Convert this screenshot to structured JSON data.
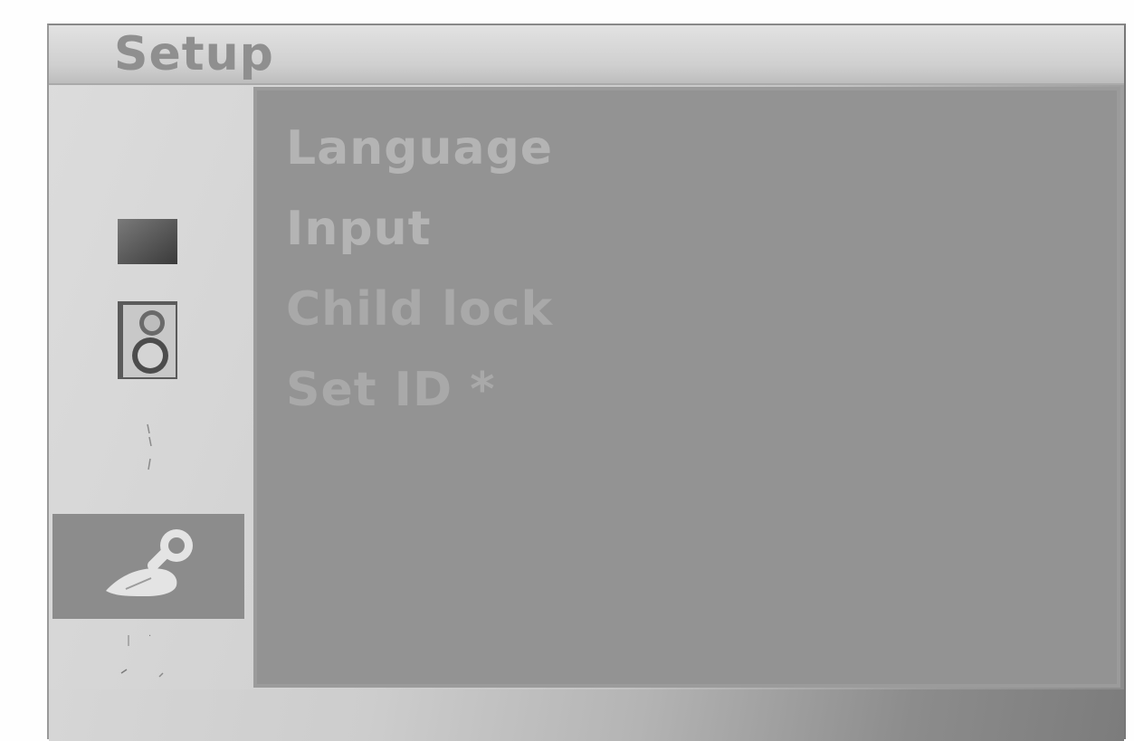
{
  "window": {
    "title": "Setup"
  },
  "sidebar": {
    "items": [
      {
        "icon": "picture-icon",
        "selected": false
      },
      {
        "icon": "speaker-icon",
        "selected": false
      },
      {
        "icon": "clock-icon",
        "selected": false
      },
      {
        "icon": "setup-wrench-icon",
        "selected": true
      },
      {
        "icon": "screen-icon",
        "selected": false
      }
    ]
  },
  "menu": {
    "items": [
      {
        "label": "Language"
      },
      {
        "label": "Input"
      },
      {
        "label": "Child lock"
      },
      {
        "label": "Set ID *"
      }
    ]
  },
  "colors": {
    "panel": "#939393",
    "selected_sidebar": "#8c8c8c",
    "menu_text": "#b4b4b4",
    "title_text": "#8f8f8f"
  }
}
